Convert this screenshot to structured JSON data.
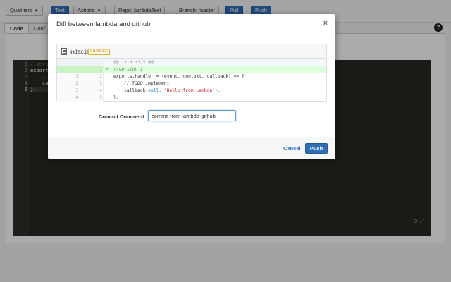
{
  "toolbar": {
    "qualifiers_label": "Qualifiers",
    "test_label": "Test",
    "actions_label": "Actions",
    "repo_label": "Repo: lambdaTest",
    "branch_label": "Branch: master",
    "pull_label": "Pull",
    "push_label": "Push"
  },
  "tabs": [
    {
      "label": "Code"
    },
    {
      "label": "Conf"
    }
  ],
  "editor": {
    "lines": [
      {
        "num": "1",
        "text": "//versi"
      },
      {
        "num": "2",
        "text": "exports"
      },
      {
        "num": "3",
        "text": "    //"
      },
      {
        "num": "4",
        "text": "    ca"
      },
      {
        "num": "5",
        "text": "};"
      }
    ]
  },
  "modal": {
    "title": "Diff between lambda and github",
    "close_glyph": "×",
    "file_name": "index.js",
    "file_badge": "CHANGED",
    "diff": {
      "hunk_header": "@@ -1,4 +1,5 @@",
      "added_line": {
        "new": "1",
        "mark": "+",
        "code": "//version 1"
      },
      "lines": [
        {
          "old": "1",
          "new": "2",
          "code": "exports.handler = (event, context, callback) => {"
        },
        {
          "old": "2",
          "new": "3",
          "code": "// TODO implement"
        },
        {
          "old": "3",
          "new": "4",
          "code_a": "callback(",
          "code_null": "null",
          "code_b": ", ",
          "code_str": "'Hello from Lambda'",
          "code_c": ");"
        },
        {
          "old": "4",
          "new": "5",
          "code": "};"
        }
      ]
    },
    "commit_comment_label": "Commit Comment",
    "commit_comment_value": "commit from lambda-github",
    "cancel_label": "Cancel",
    "push_label": "Push"
  },
  "colors": {
    "accent": "#2f6fb8",
    "editor_bg": "#272822",
    "added_bg": "#dfffdc"
  },
  "icons": {
    "help": "help-icon",
    "close": "close-icon",
    "file": "file-icon",
    "editor_tools": "settings-expand-icons"
  }
}
